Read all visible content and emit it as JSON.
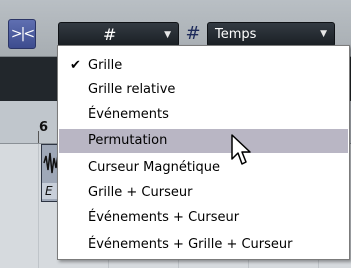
{
  "toolbar": {
    "snap_toggle_glyph": ">|<",
    "snap_type_symbol": "#",
    "grid_icon_glyph": "#",
    "grid_type_value": "Temps"
  },
  "ruler": {
    "bar_number": "6"
  },
  "clip": {
    "label": "E"
  },
  "snap_menu": {
    "checked_index": 0,
    "highlighted_index": 3,
    "items": [
      {
        "label": "Grille",
        "checked": true
      },
      {
        "label": "Grille relative"
      },
      {
        "label": "Événements"
      },
      {
        "label": "Permutation",
        "highlighted": true
      },
      {
        "label": "Curseur Magnétique"
      },
      {
        "label": "Grille + Curseur"
      },
      {
        "label": "Événements + Curseur"
      },
      {
        "label": "Événements + Grille + Curseur"
      }
    ]
  },
  "colors": {
    "highlight": "#b9b6c4",
    "toolbar": "#b3b9be",
    "dropdown_bg": "#22282e",
    "snap_toggle_active": "#4a5a9e"
  }
}
